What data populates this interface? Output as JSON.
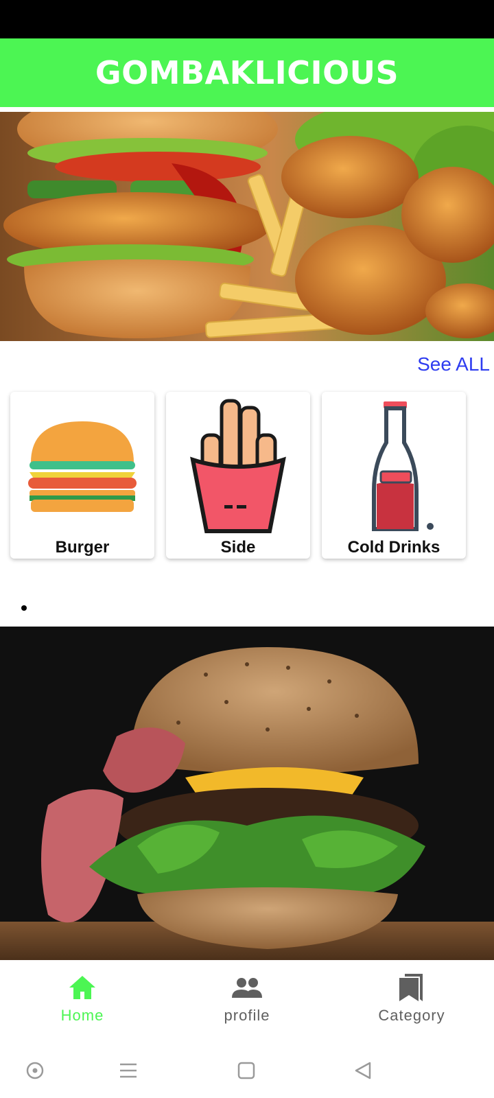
{
  "app": {
    "title": "GOMBAKLICIOUS",
    "brand_color": "#4cf553"
  },
  "banner_top": {
    "image": "burger-and-chicken-photo"
  },
  "categories": {
    "see_all_label": "See ALL",
    "items": [
      {
        "label": "Burger",
        "icon": "burger-icon"
      },
      {
        "label": "Side",
        "icon": "fries-icon"
      },
      {
        "label": "Cold Drinks",
        "icon": "soda-bottle-icon"
      }
    ]
  },
  "carousel": {
    "indicator": "dot-indicator",
    "image": "bacon-cheeseburger-photo"
  },
  "bottom_nav": {
    "active_color": "#4cf553",
    "inactive_color": "#5f5f5f",
    "items": [
      {
        "label": "Home",
        "icon": "home-icon",
        "active": true
      },
      {
        "label": "profile",
        "icon": "people-icon",
        "active": false
      },
      {
        "label": "Category",
        "icon": "bookmarks-icon",
        "active": false
      }
    ]
  },
  "system_nav": {
    "buttons": [
      "assistant-icon",
      "menu-icon",
      "home-square-icon",
      "back-icon"
    ]
  }
}
